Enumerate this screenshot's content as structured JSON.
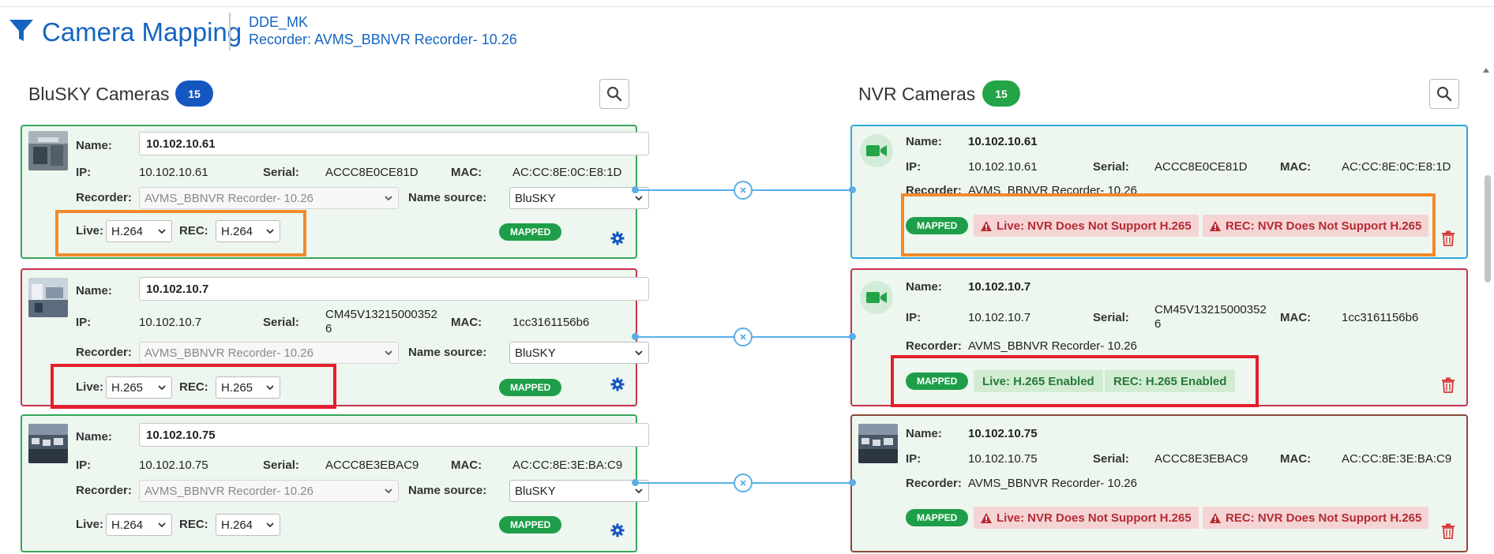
{
  "header": {
    "title": "Camera Mapping",
    "site": "DDE_MK",
    "recorder": "Recorder: AVMS_BBNVR Recorder- 10.26"
  },
  "left_panel": {
    "title": "BluSKY Cameras",
    "count": "15"
  },
  "right_panel": {
    "title": "NVR Cameras",
    "count": "15"
  },
  "labels": {
    "name": "Name:",
    "ip": "IP:",
    "serial": "Serial:",
    "mac": "MAC:",
    "recorder": "Recorder:",
    "name_source": "Name source:",
    "live": "Live:",
    "rec": "REC:",
    "mapped": "MAPPED"
  },
  "bluesky_cameras": [
    {
      "name": "10.102.10.61",
      "ip": "10.102.10.61",
      "serial": "ACCC8E0CE81D",
      "mac": "AC:CC:8E:0C:E8:1D",
      "recorder": "AVMS_BBNVR Recorder- 10.26",
      "name_source": "BluSKY",
      "live": "H.264",
      "rec": "H.264",
      "status": "MAPPED"
    },
    {
      "name": "10.102.10.7",
      "ip": "10.102.10.7",
      "serial_line1": "CM45V13215000352",
      "serial_line2": "6",
      "mac": "1cc3161156b6",
      "recorder": "AVMS_BBNVR Recorder- 10.26",
      "name_source": "BluSKY",
      "live": "H.265",
      "rec": "H.265",
      "status": "MAPPED"
    },
    {
      "name": "10.102.10.75",
      "ip": "10.102.10.75",
      "serial": "ACCC8E3EBAC9",
      "mac": "AC:CC:8E:3E:BA:C9",
      "recorder": "AVMS_BBNVR Recorder- 10.26",
      "name_source": "BluSKY",
      "live": "H.264",
      "rec": "H.264",
      "status": "MAPPED"
    }
  ],
  "nvr_cameras": [
    {
      "name": "10.102.10.61",
      "ip": "10.102.10.61",
      "serial": "ACCC8E0CE81D",
      "mac": "AC:CC:8E:0C:E8:1D",
      "recorder": "AVMS_BBNVR Recorder- 10.26",
      "status": "MAPPED",
      "live_msg": "Live: NVR Does Not Support H.265",
      "rec_msg": "REC: NVR Does Not Support H.265"
    },
    {
      "name": "10.102.10.7",
      "ip": "10.102.10.7",
      "serial_line1": "CM45V13215000352",
      "serial_line2": "6",
      "mac": "1cc3161156b6",
      "recorder": "AVMS_BBNVR Recorder- 10.26",
      "status": "MAPPED",
      "live_msg": "Live: H.265 Enabled",
      "rec_msg": "REC: H.265 Enabled"
    },
    {
      "name": "10.102.10.75",
      "ip": "10.102.10.75",
      "serial": "ACCC8E3EBAC9",
      "mac": "AC:CC:8E:3E:BA:C9",
      "recorder": "AVMS_BBNVR Recorder- 10.26",
      "status": "MAPPED",
      "live_msg": "Live: NVR Does Not Support H.265",
      "rec_msg": "REC: NVR Does Not Support H.265"
    }
  ],
  "colors": {
    "brand_blue": "#1565c0",
    "mapped_green": "#1e9e48",
    "card_bg": "#edf7ef",
    "warning_red": "#b52b33",
    "highlight_orange": "#f28a2c",
    "highlight_red": "#e51e2c"
  }
}
